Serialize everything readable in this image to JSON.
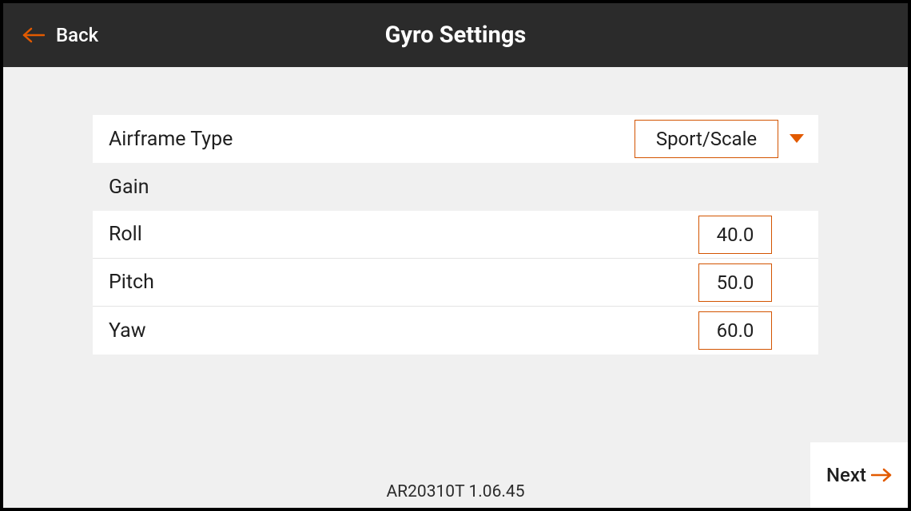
{
  "header": {
    "back_label": "Back",
    "title": "Gyro Settings"
  },
  "settings": {
    "airframe_type": {
      "label": "Airframe Type",
      "value": "Sport/Scale"
    },
    "gain_section_label": "Gain",
    "gains": {
      "roll": {
        "label": "Roll",
        "value": "40.0"
      },
      "pitch": {
        "label": "Pitch",
        "value": "50.0"
      },
      "yaw": {
        "label": "Yaw",
        "value": "60.0"
      }
    }
  },
  "footer": {
    "version": "AR20310T 1.06.45",
    "next_label": "Next"
  },
  "colors": {
    "accent": "#e25a00",
    "header_bg": "#2b2b2b",
    "page_bg": "#f0f0f0",
    "row_bg": "#ffffff"
  }
}
